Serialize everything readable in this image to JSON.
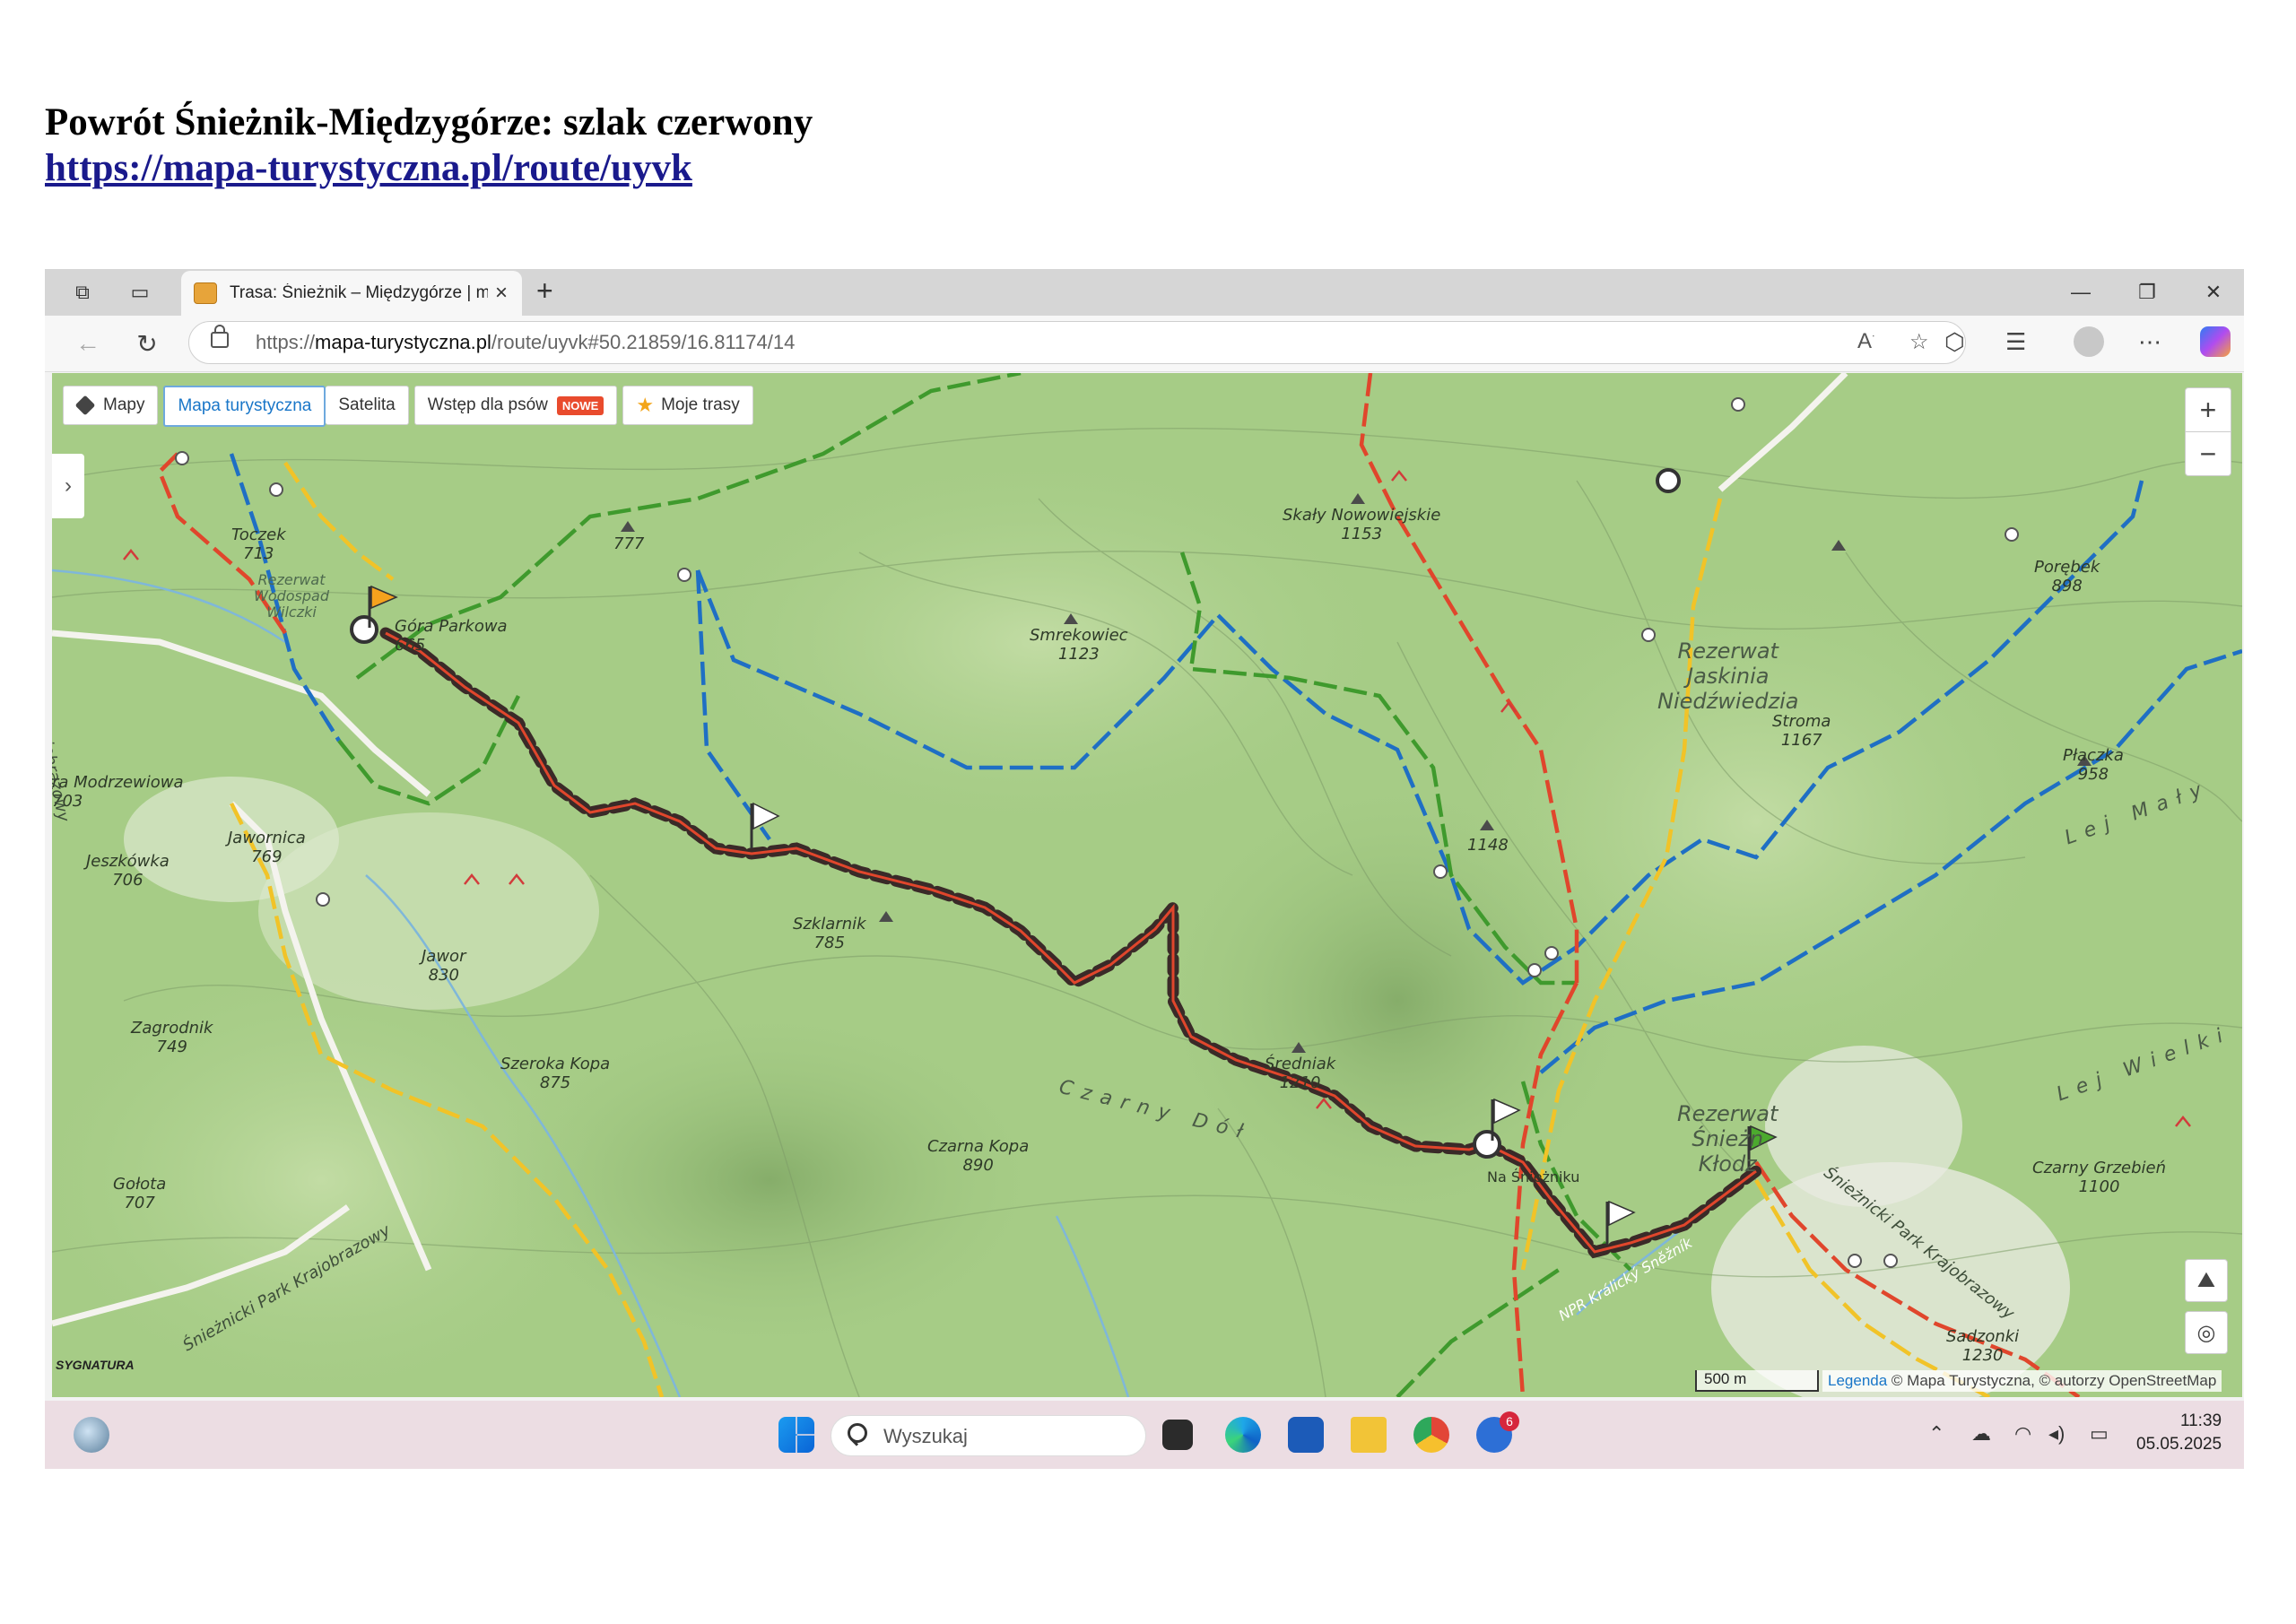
{
  "document": {
    "title": "Powrót Śnieżnik-Międzygórze: szlak czerwony",
    "link": "https://mapa-turystyczna.pl/route/uyvk"
  },
  "browser": {
    "tab_title": "Trasa: Śnieżnik – Międzygórze | m",
    "tab_close": "×",
    "new_tab": "+",
    "url_prefix": "https://",
    "url_host": "mapa-turystyczna.pl",
    "url_path": "/route/uyvk#50.21859/16.81174/14",
    "minimize": "—",
    "restore": "❐",
    "close": "✕"
  },
  "map_toolbar": {
    "maps": "Mapy",
    "tourist_map": "Mapa turystyczna",
    "satellite": "Satelita",
    "dogs": "Wstęp dla psów",
    "new_badge": "NOWE",
    "my_routes": "Moje trasy"
  },
  "map_controls": {
    "zoom_in": "+",
    "zoom_out": "−",
    "side_toggle": "›"
  },
  "map_labels": [
    {
      "id": "toczek",
      "text": "Toczek\n713"
    },
    {
      "id": "rezerwat-wodospad",
      "text": "Rezerwat\nWodospad\nWilczki"
    },
    {
      "id": "gora-parkowa",
      "text": "Góra Parkowa\n665"
    },
    {
      "id": "p777",
      "text": "777"
    },
    {
      "id": "skaly",
      "text": "Skały Nowowiejskie\n1153"
    },
    {
      "id": "smrekowiec",
      "text": "Smrekowiec\n1123"
    },
    {
      "id": "rezerwat-jaskinia",
      "text": "Rezerwat\nJaskinia\nNiedźwiedzia"
    },
    {
      "id": "porebek",
      "text": "Porębek\n898"
    },
    {
      "id": "stroma",
      "text": "Stroma\n1167"
    },
    {
      "id": "placzka",
      "text": "Płaczka\n958"
    },
    {
      "id": "modrzewiowa",
      "text": "ra Modrzewiowa\n703"
    },
    {
      "id": "jawornica",
      "text": "Jawornica\n769"
    },
    {
      "id": "jeszkowka",
      "text": "Jeszkówka\n706"
    },
    {
      "id": "p1148",
      "text": "1148"
    },
    {
      "id": "szklarnik",
      "text": "Szklarnik\n785"
    },
    {
      "id": "jawor",
      "text": "Jawor\n830"
    },
    {
      "id": "zagrodnik",
      "text": "Zagrodnik\n749"
    },
    {
      "id": "szeroka-kopa",
      "text": "Szeroka Kopa\n875"
    },
    {
      "id": "sredniak",
      "text": "Średniak\n1210"
    },
    {
      "id": "czarny-dol",
      "text": "Czarny Dół"
    },
    {
      "id": "czarna-kopa",
      "text": "Czarna Kopa\n890"
    },
    {
      "id": "na-snieznik",
      "text": "Na Śnieżniku"
    },
    {
      "id": "rezerwat-snieznik",
      "text": "Rezerwat\nŚnieżn\nKłodz"
    },
    {
      "id": "czarny-grzebien",
      "text": "Czarny Grzebień\n1100"
    },
    {
      "id": "golota",
      "text": "Gołota\n707"
    },
    {
      "id": "sadzonki",
      "text": "Sadzonki\n1230"
    },
    {
      "id": "npr",
      "text": "NPR Králický Sněžník"
    },
    {
      "id": "park-snieznicki",
      "text": "Śnieżnicki Park Krajobrazowy"
    },
    {
      "id": "park-snieznicki-2",
      "text": "Śnieżnicki Park Krajobrazowy"
    },
    {
      "id": "lej-maly",
      "text": "Lej Mały"
    },
    {
      "id": "lej-wielki",
      "text": "Lej Wielki"
    },
    {
      "id": "park-left",
      "text": "icki Park Krajobrazowy"
    }
  ],
  "map_footer": {
    "scale": "500 m",
    "legend": "Legenda",
    "attribution": " © Mapa Turystyczna, © autorzy OpenStreetMap",
    "logo": "SYGNATURA"
  },
  "taskbar": {
    "search_placeholder": "Wyszukaj",
    "notification_count": "6",
    "time": "11:39",
    "date": "05.05.2025"
  },
  "colors": {
    "map_background": "#a6cc86",
    "route_red": "#e0462c",
    "route_highlight": "#3a2a28",
    "trail_blue": "#1f6fc4",
    "trail_green": "#3f9a2d",
    "trail_yellow": "#f1c328",
    "taskbar": "#ecdde3"
  }
}
